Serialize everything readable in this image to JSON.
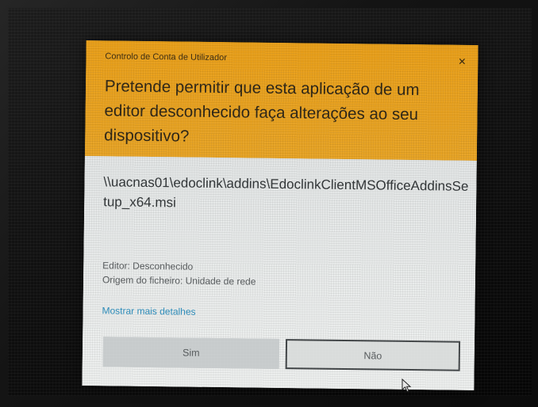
{
  "dialog": {
    "title": "Controlo de Conta de Utilizador",
    "close_symbol": "×",
    "question": "Pretende permitir que esta aplicação de um editor desconhecido faça alterações ao seu dispositivo?",
    "program_path": "\\\\uacnas01\\edoclink\\addins\\EdoclinkClientMSOfficeAddinsSetup_x64.msi",
    "publisher_line": "Editor: Desconhecido",
    "origin_line": "Origem do ficheiro: Unidade de rede",
    "more_details_link": "Mostrar mais detalhes",
    "yes_button": "Sim",
    "no_button": "Não"
  },
  "colors": {
    "header": "#e9a31d",
    "body": "#eceeee",
    "link": "#2a8ab8"
  },
  "icons": {
    "close": "close-icon",
    "cursor": "mouse-pointer-icon"
  }
}
